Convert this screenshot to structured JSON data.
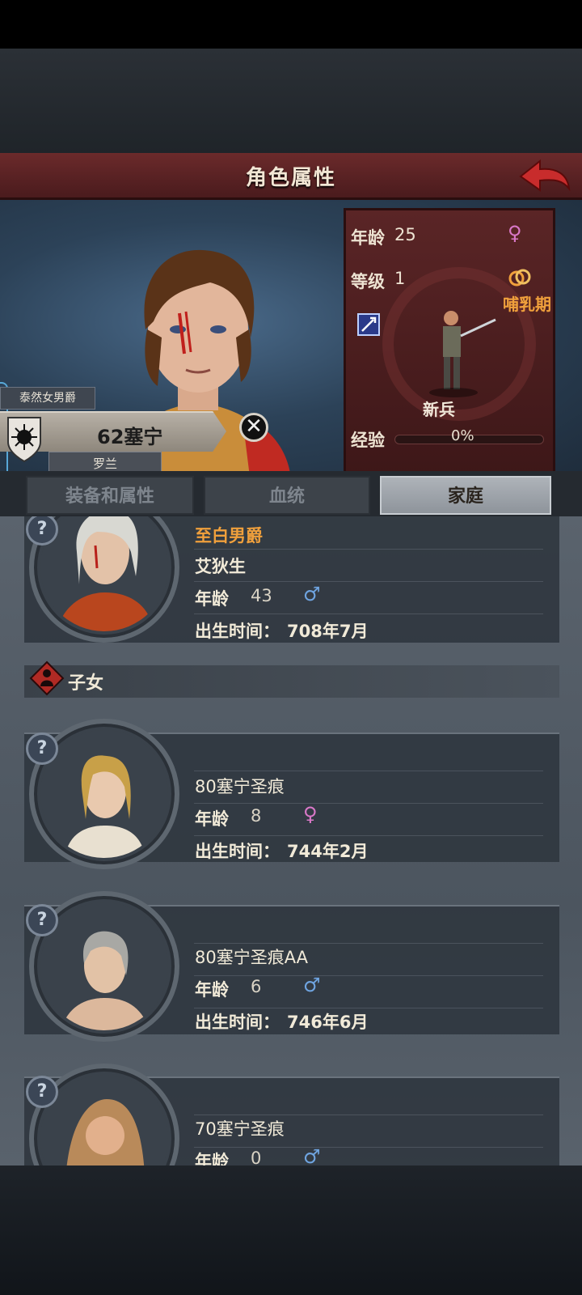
{
  "header": {
    "title": "角色属性"
  },
  "character": {
    "title_tag": "泰然女男爵",
    "name": "62塞宁",
    "house": "罗兰"
  },
  "stats": {
    "age_label": "年龄",
    "age_value": "25",
    "level_label": "等级",
    "level_value": "1",
    "stage": "哺乳期",
    "class_name": "新兵",
    "exp_label": "经验",
    "exp_value": "0%",
    "exp_fraction": 0
  },
  "tabs": [
    {
      "label": "装备和属性"
    },
    {
      "label": "血统"
    },
    {
      "label": "家庭"
    }
  ],
  "family": {
    "spouse": {
      "title": "至白男爵",
      "name": "艾狄生",
      "age_label": "年龄",
      "age": "43",
      "gender": "♂",
      "birth_label": "出生时间：",
      "birth": "708年7月"
    },
    "children_label": "子女",
    "children": [
      {
        "name": "80塞宁圣痕",
        "age_label": "年龄",
        "age": "8",
        "gender": "♀",
        "birth_label": "出生时间：",
        "birth": "744年2月"
      },
      {
        "name": "80塞宁圣痕AA",
        "age_label": "年龄",
        "age": "6",
        "gender": "♂",
        "birth_label": "出生时间：",
        "birth": "746年6月"
      },
      {
        "name": "70塞宁圣痕",
        "age_label": "年龄",
        "age": "0",
        "gender": "♂"
      }
    ],
    "help_glyph": "?"
  },
  "close_glyph": "✕",
  "colors": {
    "accent_orange": "#f0a03c",
    "male_blue": "#6fa4e0",
    "female_pink": "#d978c8",
    "header_red": "#6b2a2b"
  }
}
